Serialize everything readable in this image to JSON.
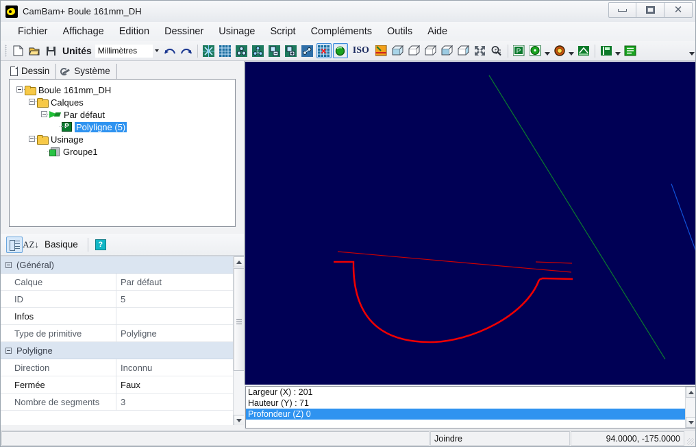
{
  "window": {
    "title": "CamBam+  Boule 161mm_DH",
    "icon": "cambam-app-icon",
    "controls": {
      "minimize": "–",
      "maximize": "❐",
      "close": "✕"
    }
  },
  "menubar": {
    "items": [
      {
        "label": "Fichier"
      },
      {
        "label": "Affichage"
      },
      {
        "label": "Edition"
      },
      {
        "label": "Dessiner"
      },
      {
        "label": "Usinage"
      },
      {
        "label": "Script"
      },
      {
        "label": "Compléments"
      },
      {
        "label": "Outils"
      },
      {
        "label": "Aide"
      }
    ]
  },
  "toolbar": {
    "units_label": "Unités",
    "units_value": "Millimètres",
    "iso_label": "ISO",
    "buttons": [
      {
        "name": "new-file-icon"
      },
      {
        "name": "open-file-icon"
      },
      {
        "name": "save-file-icon"
      },
      {
        "name": "undo-icon"
      },
      {
        "name": "redo-icon"
      },
      {
        "name": "snap-icon"
      },
      {
        "name": "grid-icon"
      },
      {
        "name": "points-icon"
      },
      {
        "name": "points-group-icon"
      },
      {
        "name": "points-minus-icon"
      },
      {
        "name": "points-plus-icon"
      },
      {
        "name": "points-move-icon"
      },
      {
        "name": "grid-snap-icon"
      },
      {
        "name": "object-snap-icon"
      },
      {
        "name": "view-xy-icon"
      },
      {
        "name": "view-box1-icon"
      },
      {
        "name": "view-box2-icon"
      },
      {
        "name": "view-box3-icon"
      },
      {
        "name": "view-box4-icon"
      },
      {
        "name": "view-box5-icon"
      },
      {
        "name": "zoom-fit-icon"
      },
      {
        "name": "zoom-window-icon"
      },
      {
        "name": "polyline-icon"
      },
      {
        "name": "circle-icon"
      },
      {
        "name": "machining-icon"
      },
      {
        "name": "profile-icon"
      },
      {
        "name": "toolpath-icon"
      },
      {
        "name": "list-icon"
      }
    ]
  },
  "left_panel": {
    "tabs": [
      {
        "label": "Dessin",
        "icon": "page-icon",
        "active": true
      },
      {
        "label": "Système",
        "icon": "wrench-icon",
        "active": false
      }
    ],
    "tree": [
      {
        "label": "Boule 161mm_DH",
        "icon": "folder-icon",
        "depth": 0,
        "expander": true,
        "selected": false
      },
      {
        "label": "Calques",
        "icon": "folder-icon",
        "depth": 1,
        "expander": true,
        "selected": false
      },
      {
        "label": "Par défaut",
        "icon": "layer-icon",
        "depth": 2,
        "expander": true,
        "selected": false
      },
      {
        "label": "Polyligne (5)",
        "icon": "polyline-icon",
        "depth": 3,
        "expander": false,
        "selected": true
      },
      {
        "label": "Usinage",
        "icon": "folder-icon",
        "depth": 1,
        "expander": true,
        "selected": false
      },
      {
        "label": "Groupe1",
        "icon": "group-icon",
        "depth": 2,
        "expander": false,
        "selected": false
      }
    ]
  },
  "property_panel": {
    "toolbar": {
      "categorized_icon": "categorized-view-icon",
      "alphabetical_icon": "alphabetical-sort-icon",
      "mode_label": "Basique",
      "help_icon": "help-icon"
    },
    "rows": [
      {
        "type": "category",
        "name": "(Général)"
      },
      {
        "type": "prop",
        "name": "Calque",
        "value": "Par défaut",
        "bold": false
      },
      {
        "type": "prop",
        "name": "ID",
        "value": "5",
        "bold": false
      },
      {
        "type": "prop",
        "name": "Infos",
        "value": "",
        "bold": true
      },
      {
        "type": "prop",
        "name": "Type de primitive",
        "value": "Polyligne",
        "bold": false
      },
      {
        "type": "category",
        "name": "Polyligne"
      },
      {
        "type": "prop",
        "name": "Direction",
        "value": "Inconnu",
        "bold": false
      },
      {
        "type": "prop",
        "name": "Fermée",
        "value": "Faux",
        "bold": true
      },
      {
        "type": "prop",
        "name": "Nombre de segments",
        "value": "3",
        "bold": false
      }
    ]
  },
  "viewport": {
    "background_color": "#000055",
    "geometry_color": "#e00000",
    "axis_y_color": "#1050d8",
    "axis_x_color": "#0a7a2e"
  },
  "info_panel": {
    "lines": [
      {
        "text": "Largeur (X) : 201",
        "selected": false
      },
      {
        "text": "Hauteur (Y) : 71",
        "selected": false
      },
      {
        "text": "Profondeur (Z) 0",
        "selected": true
      }
    ]
  },
  "status_bar": {
    "message": "",
    "mode": "Joindre",
    "coordinates": "94.0000, -175.0000"
  }
}
